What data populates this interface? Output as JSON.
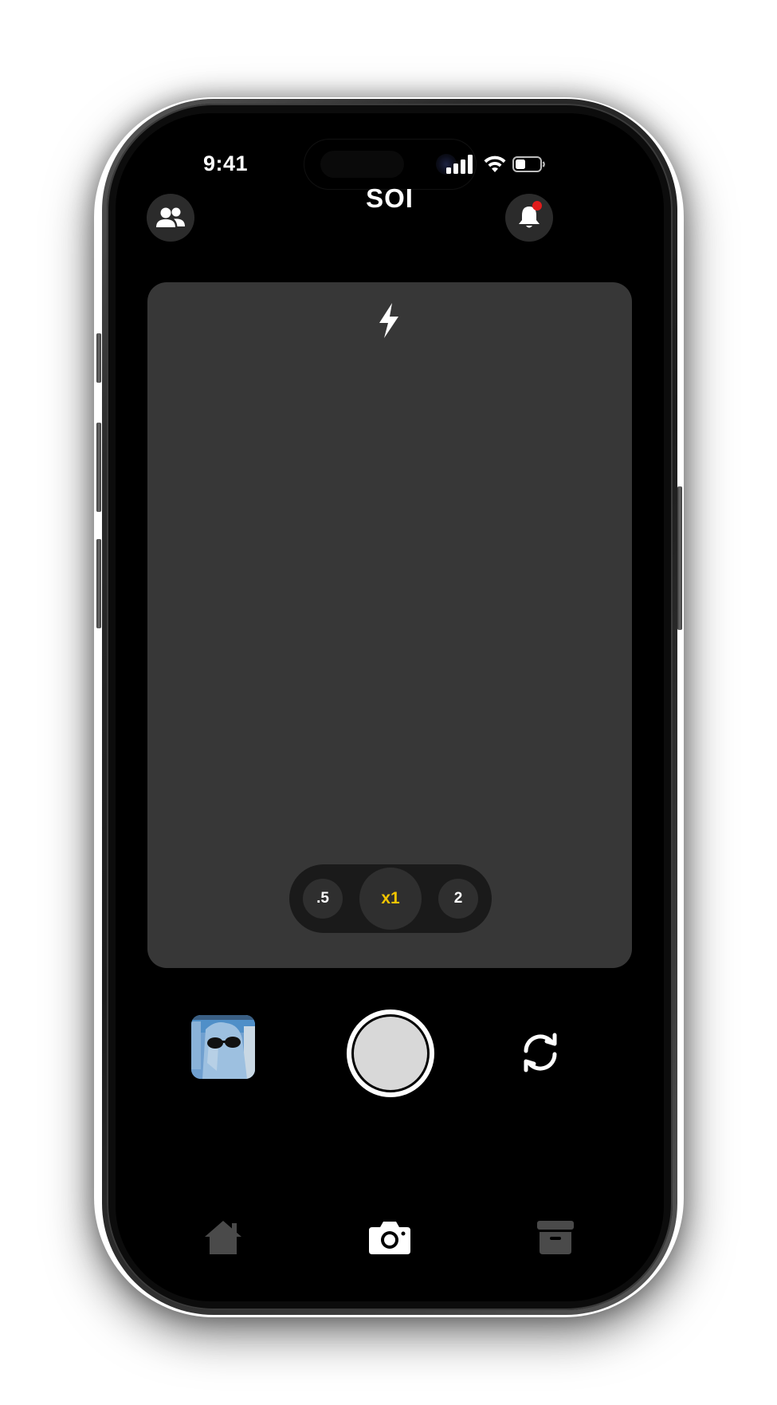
{
  "status_bar": {
    "time": "9:41",
    "icons": [
      "signal-icon",
      "wifi-icon",
      "battery-icon"
    ],
    "battery_level": 0.4
  },
  "header": {
    "title": "SOI",
    "left_icon": "friends-icon",
    "right_icon": "bell-icon",
    "notification_dot_color": "#e11b1b"
  },
  "camera": {
    "flash_icon": "flash-icon",
    "zoom_options": [
      {
        "label": ".5",
        "selected": false
      },
      {
        "label": "x1",
        "selected": true
      },
      {
        "label": "2",
        "selected": false
      }
    ],
    "accent_color": "#f2c500",
    "shutter_icon": "shutter-button",
    "flip_icon": "flip-camera-icon",
    "gallery_icon": "gallery-thumbnail"
  },
  "tab_bar": {
    "items": [
      {
        "name": "home",
        "icon": "home-icon",
        "active": false
      },
      {
        "name": "camera",
        "icon": "camera-icon",
        "active": true
      },
      {
        "name": "archive",
        "icon": "archive-icon",
        "active": false
      }
    ]
  }
}
